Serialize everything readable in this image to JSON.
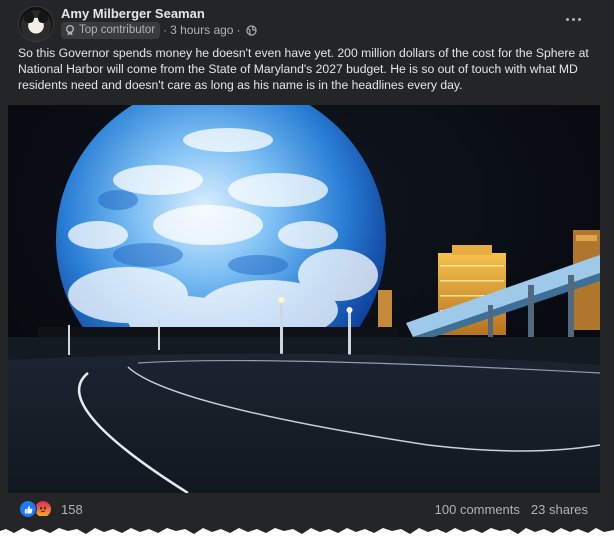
{
  "post": {
    "author": "Amy Milberger Seaman",
    "badge": "Top contributor",
    "time": "3 hours ago",
    "time_separator": "·",
    "text": "So this Governor spends money he doesn't even have yet. 200 million dollars of the cost for the Sphere at National Harbor will come from the State of Maryland's 2027 budget. He is so out of touch with what MD residents need and doesn't care as long as his name is in the headlines every day.",
    "privacy_icon": "globe-icon",
    "more_icon": "more-options-icon"
  },
  "engagement": {
    "reaction_icons": [
      "like-icon",
      "angry-icon"
    ],
    "reaction_count": "158",
    "comments": "100 comments",
    "shares": "23 shares"
  },
  "colors": {
    "card_bg": "#242526",
    "text_primary": "#e4e6eb",
    "text_secondary": "#b0b3b8",
    "like_blue": "#2078f4"
  }
}
